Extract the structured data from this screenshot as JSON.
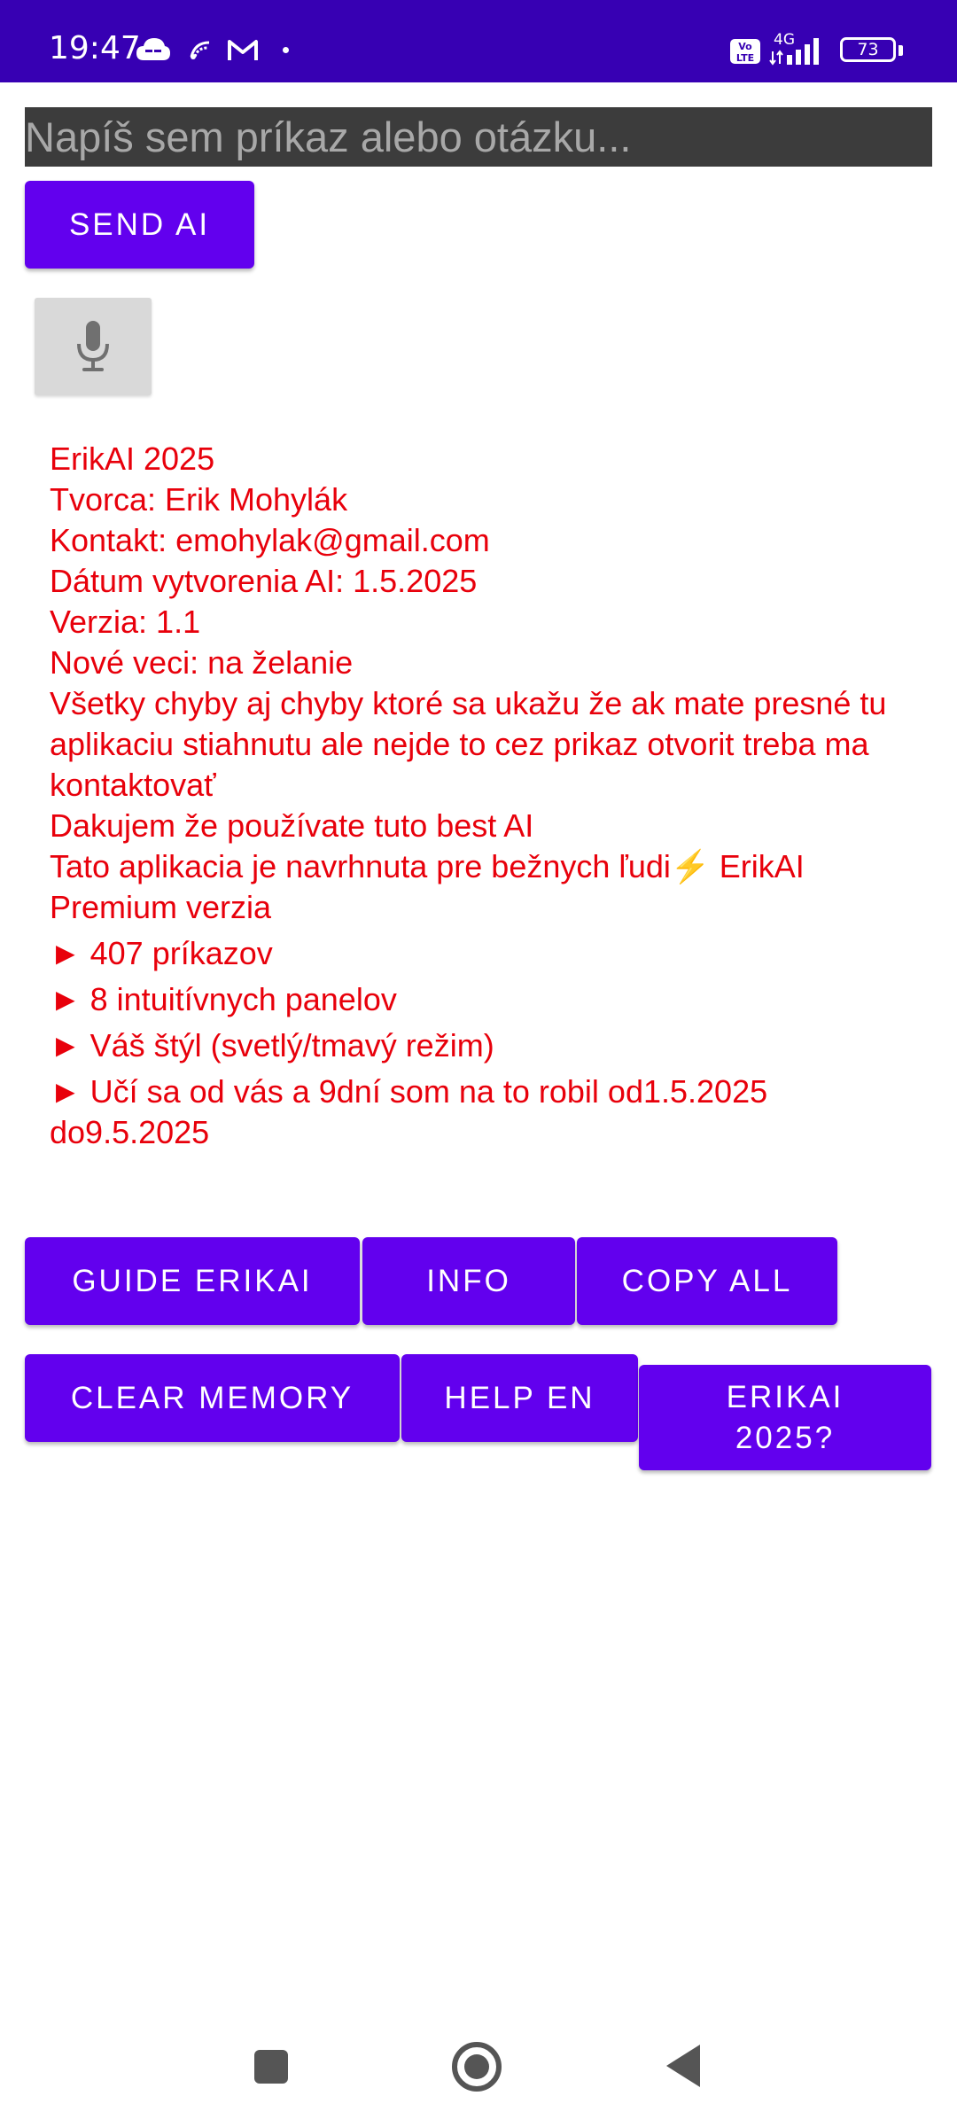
{
  "status_bar": {
    "time": "19:47",
    "battery_level": "73",
    "network": "4G",
    "volte": "Vo LTE",
    "background_color": "#3700b3",
    "icons": [
      "cloud-icon",
      "app-notification-icon",
      "gmail-icon",
      "notification-dot-icon",
      "volte-icon",
      "signal-icon",
      "battery-icon"
    ]
  },
  "input": {
    "placeholder": "Napíš sem príkaz alebo otázku...",
    "value": ""
  },
  "buttons": {
    "send": "SEND AI",
    "guide": "GUIDE ERIKAI",
    "info": "INFO",
    "copy_all": "COPY ALL",
    "clear_memory": "CLEAR MEMORY",
    "help_en": "HELP EN",
    "erikai_2025": "ERIKAI 2025?"
  },
  "info": {
    "lines": [
      "ErikAI 2025",
      "Tvorca: Erik Mohylák",
      "Kontakt: emohylak@gmail.com",
      "Dátum vytvorenia AI: 1.5.2025",
      "Verzia: 1.1",
      "Nové veci: na želanie",
      "Všetky chyby aj chyby ktoré sa ukažu že ak mate presné tu aplikaciu stiahnutu ale nejde to cez prikaz otvorit treba ma kontaktovať",
      "Dakujem že používate tuto best AI",
      "Tato aplikacia je navrhnuta pre bežnych ľudi⚡ ErikAI Premium verzia"
    ],
    "features": [
      "► 407 príkazov",
      "► 8 intuitívnych panelov",
      "► Váš štýl (svetlý/tmavý režim)",
      "► Učí sa od vás a 9dní som na to robil od1.5.2025 do9.5.2025"
    ]
  },
  "colors": {
    "accent": "#6200ee",
    "info_text": "#e8000b",
    "input_background": "#3c3c3c"
  }
}
